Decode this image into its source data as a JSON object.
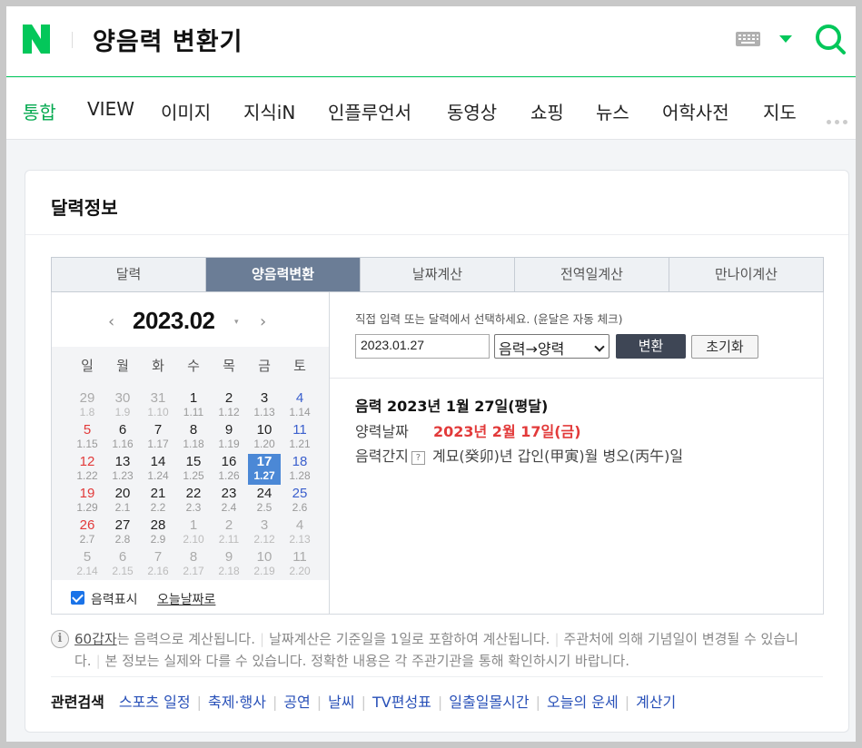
{
  "header": {
    "search_query": "양음력 변환기"
  },
  "nav": {
    "items": [
      "통합",
      "VIEW",
      "이미지",
      "지식iN",
      "인플루언서",
      "동영상",
      "쇼핑",
      "뉴스",
      "어학사전",
      "지도"
    ],
    "active": "통합"
  },
  "card": {
    "title": "달력정보",
    "tabs": [
      "달력",
      "양음력변환",
      "날짜계산",
      "전역일계산",
      "만나이계산"
    ],
    "active_tab": "양음력변환"
  },
  "calendar": {
    "prev": "‹",
    "next": "›",
    "month": "2023.02",
    "dropdown": "▾",
    "weekdays": [
      "일",
      "월",
      "화",
      "수",
      "목",
      "금",
      "토"
    ],
    "weeks": [
      [
        [
          "29",
          "1.8",
          true
        ],
        [
          "30",
          "1.9",
          true
        ],
        [
          "31",
          "1.10",
          true
        ],
        [
          "1",
          "1.11",
          false
        ],
        [
          "2",
          "1.12",
          false
        ],
        [
          "3",
          "1.13",
          false
        ],
        [
          "4",
          "1.14",
          false
        ]
      ],
      [
        [
          "5",
          "1.15",
          false
        ],
        [
          "6",
          "1.16",
          false
        ],
        [
          "7",
          "1.17",
          false
        ],
        [
          "8",
          "1.18",
          false
        ],
        [
          "9",
          "1.19",
          false
        ],
        [
          "10",
          "1.20",
          false
        ],
        [
          "11",
          "1.21",
          false
        ]
      ],
      [
        [
          "12",
          "1.22",
          false
        ],
        [
          "13",
          "1.23",
          false
        ],
        [
          "14",
          "1.24",
          false
        ],
        [
          "15",
          "1.25",
          false
        ],
        [
          "16",
          "1.26",
          false
        ],
        [
          "17",
          "1.27",
          false
        ],
        [
          "18",
          "1.28",
          false
        ]
      ],
      [
        [
          "19",
          "1.29",
          false
        ],
        [
          "20",
          "2.1",
          false
        ],
        [
          "21",
          "2.2",
          false
        ],
        [
          "22",
          "2.3",
          false
        ],
        [
          "23",
          "2.4",
          false
        ],
        [
          "24",
          "2.5",
          false
        ],
        [
          "25",
          "2.6",
          false
        ]
      ],
      [
        [
          "26",
          "2.7",
          false
        ],
        [
          "27",
          "2.8",
          false
        ],
        [
          "28",
          "2.9",
          false
        ],
        [
          "1",
          "2.10",
          true
        ],
        [
          "2",
          "2.11",
          true
        ],
        [
          "3",
          "2.12",
          true
        ],
        [
          "4",
          "2.13",
          true
        ]
      ],
      [
        [
          "5",
          "2.14",
          true
        ],
        [
          "6",
          "2.15",
          true
        ],
        [
          "7",
          "2.16",
          true
        ],
        [
          "8",
          "2.17",
          true
        ],
        [
          "9",
          "2.18",
          true
        ],
        [
          "10",
          "2.19",
          true
        ],
        [
          "11",
          "2.20",
          true
        ]
      ]
    ],
    "selected_day": "17",
    "show_lunar_label": "음력표시",
    "show_lunar_checked": true,
    "today_link": "오늘날짜로"
  },
  "converter": {
    "hint": "직접 입력 또는 달력에서 선택하세요. (윤달은 자동 체크)",
    "input_value": "2023.01.27",
    "mode_selected": "음력→양력",
    "convert_button": "변환",
    "reset_button": "초기화",
    "result_main": "음력 2023년 1월 27일(평달)",
    "solar_label": "양력날짜",
    "solar_value": "2023년 2월 17일(금)",
    "ganji_label": "음력간지",
    "help_icon": "?",
    "ganji_value": "계묘(癸卯)년 갑인(甲寅)월 병오(丙午)일"
  },
  "notes": {
    "info_icon": "i",
    "link": "60갑자",
    "text1": "는 음력으로 계산됩니다.",
    "text2": "날짜계산은 기준일을 1일로 포함하여 계산됩니다.",
    "text3": "주관처에 의해 기념일이 변경될 수 있습니다.",
    "text4": "본 정보는 실제와 다를 수 있습니다. 정확한 내용은 각 주관기관을 통해 확인하시기 바랍니다."
  },
  "related": {
    "label": "관련검색",
    "items": [
      "스포츠 일정",
      "축제·행사",
      "공연",
      "날씨",
      "TV편성표",
      "일출일몰시간",
      "오늘의 운세",
      "계산기"
    ]
  },
  "colors": {
    "brand_green": "#03c75a",
    "tab_active": "#6b7d96",
    "selected_day": "#4b88d6",
    "sunday": "#e23a3a",
    "saturday": "#3a5fcd",
    "result_red": "#e23a3a",
    "link_blue": "#2850b8"
  }
}
